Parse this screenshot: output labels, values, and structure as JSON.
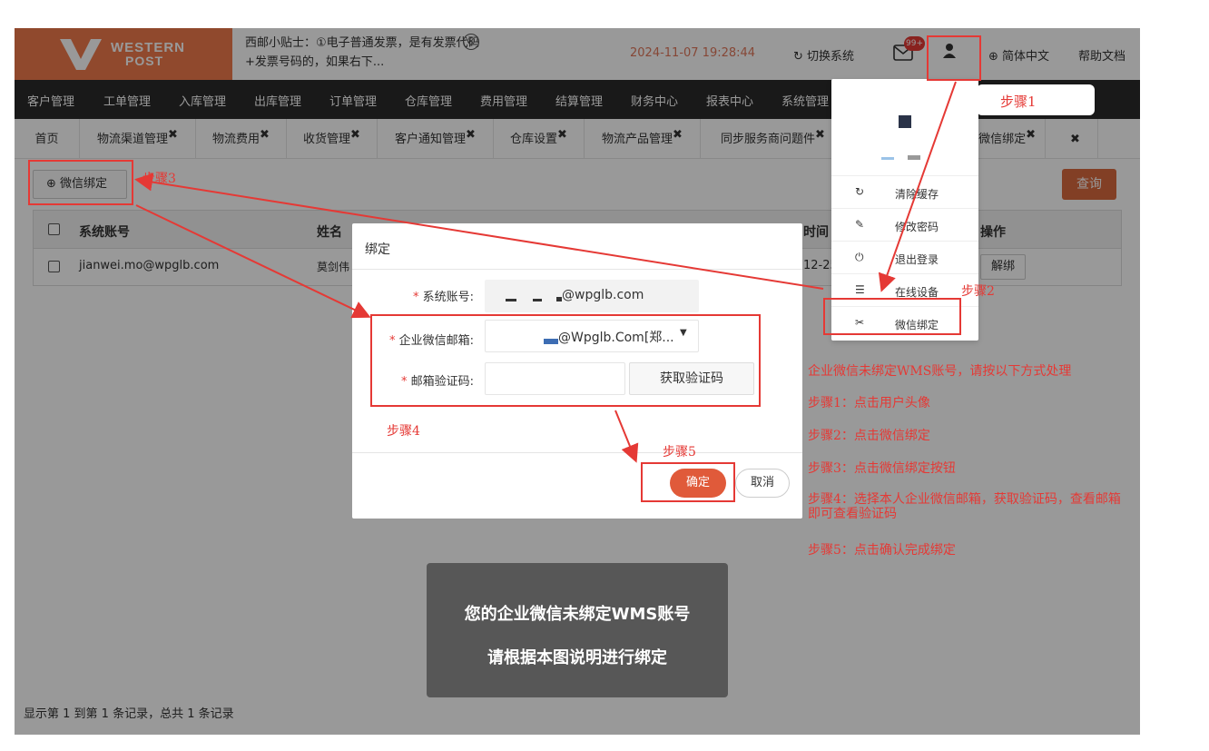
{
  "header": {
    "logo_line1": "WESTERN",
    "logo_line2": "POST",
    "tip_text": "西邮小贴士：①电子普通发票，是有发票代码+发票号码的，如果右下...",
    "tip_close": "⊗",
    "datetime": "2024-11-07 19:28:44",
    "switch_system": "切换系统",
    "badge": "99+",
    "language": "简体中文",
    "help": "帮助文档"
  },
  "nav": [
    "客户管理",
    "工单管理",
    "入库管理",
    "出库管理",
    "订单管理",
    "仓库管理",
    "费用管理",
    "结算管理",
    "财务中心",
    "报表中心",
    "系统管理"
  ],
  "tabs": [
    {
      "label": "首页",
      "closable": false
    },
    {
      "label": "物流渠道管理",
      "closable": true
    },
    {
      "label": "物流费用",
      "closable": true
    },
    {
      "label": "收货管理",
      "closable": true
    },
    {
      "label": "客户通知管理",
      "closable": true
    },
    {
      "label": "仓库设置",
      "closable": true
    },
    {
      "label": "物流产品管理",
      "closable": true
    },
    {
      "label": "同步服务商问题件",
      "closable": true
    },
    {
      "label": "微信绑定",
      "closable": true
    }
  ],
  "toolbar": {
    "wechat_bind": "微信绑定",
    "query": "查询"
  },
  "table": {
    "headers": {
      "account": "系统账号",
      "name": "姓名",
      "time": "时间",
      "action": "操作"
    },
    "row": {
      "account": "jianwei.mo@wpglb.com",
      "name": "莫剑伟",
      "time": "12-25",
      "action": "解绑"
    }
  },
  "footer": "显示第 1 到第 1 条记录，总共 1 条记录",
  "dropdown": {
    "items": [
      {
        "icon": "refresh-icon",
        "label": "清除缓存"
      },
      {
        "icon": "pencil-icon",
        "label": "修改密码"
      },
      {
        "icon": "power-icon",
        "label": "退出登录"
      },
      {
        "icon": "list-icon",
        "label": "在线设备"
      },
      {
        "icon": "paperclip-icon",
        "label": "微信绑定"
      }
    ]
  },
  "modal": {
    "title": "绑定",
    "account_label": "系统账号:",
    "account_value": "@wpglb.com",
    "wx_email_label": "企业微信邮箱:",
    "wx_email_value": "@Wpglb.Com[郑...",
    "code_label": "邮箱验证码:",
    "get_code": "获取验证码",
    "ok": "确定",
    "cancel": "取消"
  },
  "annotations": {
    "step1": "步骤1",
    "step2": "步骤2",
    "step3": "步骤3",
    "step4": "步骤4",
    "step5": "步骤5",
    "guide_title": "企业微信未绑定WMS账号，请按以下方式处理",
    "guide": [
      "步骤1：点击用户头像",
      "步骤2：点击微信绑定",
      "步骤3：点击微信绑定按钮",
      "步骤4：选择本人企业微信邮箱，获取验证码，查看邮箱即可查看验证码",
      "步骤5：点击确认完成绑定"
    ]
  },
  "notice": {
    "line1": "您的企业微信未绑定WMS账号",
    "line2": "请根据本图说明进行绑定"
  },
  "colors": {
    "brand": "#f07b4c",
    "nav": "#2b2b2b",
    "annotation": "#e53935",
    "primary_button": "#e05a3a"
  }
}
